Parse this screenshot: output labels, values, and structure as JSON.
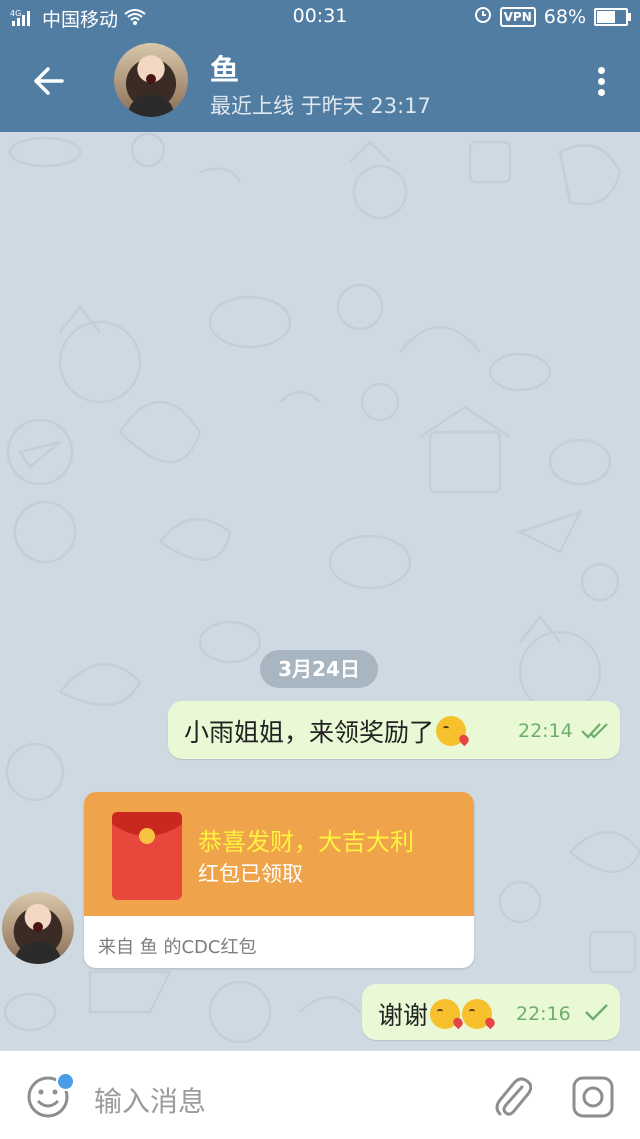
{
  "status_bar": {
    "network": "4G",
    "carrier": "中国移动",
    "time": "00:31",
    "vpn": "VPN",
    "battery_percent": "68%",
    "battery_level": 0.68
  },
  "header": {
    "contact_name": "鱼",
    "last_seen": "最近上线 于昨天 23:17"
  },
  "chat": {
    "date_divider": "3月24日",
    "messages": [
      {
        "text": "小雨姐姐，来领奖励了",
        "emoji": "😘",
        "time": "22:14",
        "status": "read"
      },
      {
        "type": "red_packet",
        "title": "恭喜发财，大吉大利",
        "subtitle": "红包已领取",
        "from": "来自 鱼 的CDC红包"
      },
      {
        "text": "谢谢",
        "emoji": "😘😘",
        "time": "22:16",
        "status": "sent"
      }
    ]
  },
  "input": {
    "placeholder": "输入消息"
  },
  "icons": {
    "back": "arrow-left-icon",
    "menu": "more-vert-icon",
    "emoji": "smile-icon",
    "attach": "paperclip-icon",
    "camera": "camera-icon"
  },
  "colors": {
    "header": "#527da3",
    "outgoing_bubble": "#e9f9d5",
    "red_packet": "#efa44b",
    "red_packet_title": "#fff33e",
    "check": "#6eae6c"
  }
}
